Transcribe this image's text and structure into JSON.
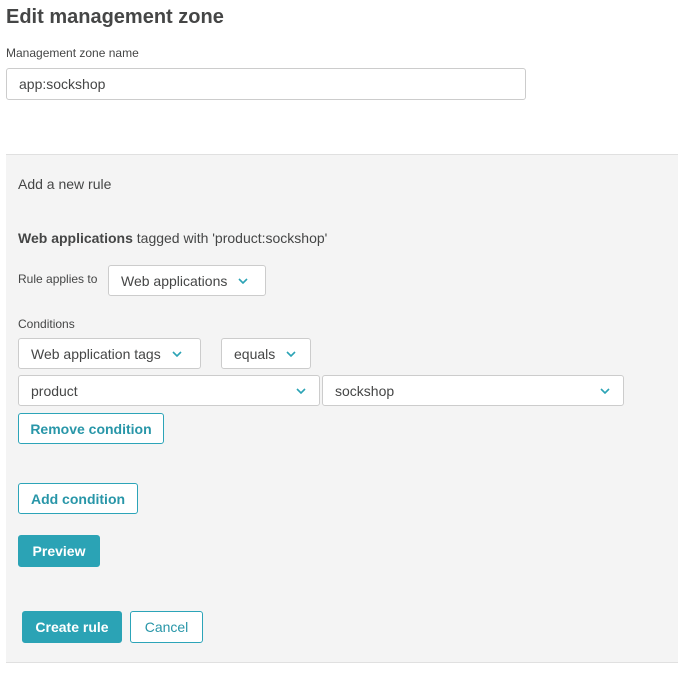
{
  "page": {
    "title": "Edit management zone",
    "zone_name_label": "Management zone name",
    "zone_name_value": "app:sockshop"
  },
  "rule_panel": {
    "heading": "Add a new rule",
    "summary_bold": "Web applications",
    "summary_rest": " tagged with 'product:sockshop'",
    "applies_to_label": "Rule applies to",
    "applies_to_value": "Web applications",
    "conditions_label": "Conditions",
    "condition": {
      "attribute": "Web application tags",
      "operator": "equals",
      "tag_key": "product",
      "tag_value": "sockshop",
      "remove_label": "Remove condition"
    },
    "add_condition_label": "Add condition",
    "preview_label": "Preview",
    "create_label": "Create rule",
    "cancel_label": "Cancel"
  },
  "colors": {
    "accent": "#2ba3b5",
    "text": "#454646",
    "panel_bg": "#f4f4f4",
    "border": "#cccccc"
  },
  "icons": {
    "dropdown": "chevron-down-icon"
  }
}
